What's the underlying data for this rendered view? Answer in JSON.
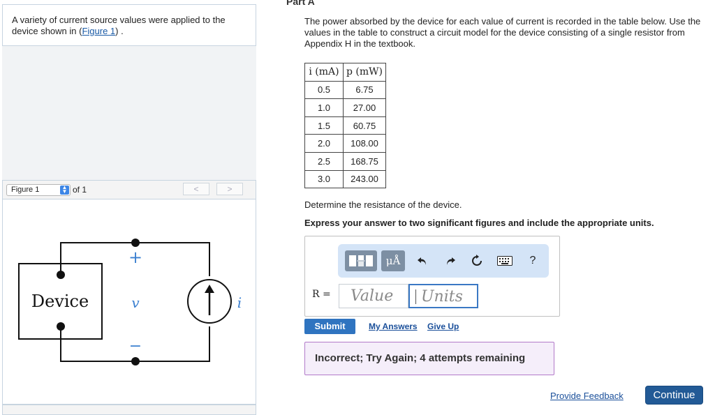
{
  "intro": {
    "text_before": "A variety of current source values were applied to the device shown in (",
    "figure_link": "Figure 1",
    "text_after": ") ."
  },
  "figure_nav": {
    "selected": "Figure 1",
    "of_label": "of 1",
    "prev": "<",
    "next": ">"
  },
  "circuit": {
    "device_label": "Device",
    "plus": "+",
    "minus": "−",
    "voltage_label": "v",
    "current_label": "i"
  },
  "part": {
    "title": "Part A",
    "problem_text": "The power absorbed by the device for each value of current is recorded in the table below. Use the values in the table to construct a circuit model for the device consisting of a single resistor from Appendix H in the textbook."
  },
  "table": {
    "headers": [
      "i (mA)",
      "p (mW)"
    ],
    "rows": [
      [
        "0.5",
        "6.75"
      ],
      [
        "1.0",
        "27.00"
      ],
      [
        "1.5",
        "60.75"
      ],
      [
        "2.0",
        "108.00"
      ],
      [
        "2.5",
        "168.75"
      ],
      [
        "3.0",
        "243.00"
      ]
    ]
  },
  "question": {
    "prompt": "Determine the resistance of the device.",
    "instruction": "Express your answer to two significant figures and include the appropriate units."
  },
  "answer": {
    "label": "R =",
    "value_placeholder": "Value",
    "units_placeholder": "Units",
    "toolbar_icons": [
      "templates-icon",
      "units-mu-icon",
      "undo-icon",
      "redo-icon",
      "reset-icon",
      "keyboard-icon",
      "help-icon"
    ],
    "mu_glyph": "μÅ",
    "help_glyph": "?"
  },
  "actions": {
    "submit": "Submit",
    "my_answers": "My Answers",
    "give_up": "Give Up"
  },
  "feedback": {
    "message": "Incorrect; Try Again; 4 attempts remaining",
    "border_color": "#b27ac9",
    "background_color": "#f5eefa"
  },
  "footer": {
    "provide_feedback": "Provide Feedback",
    "continue": "Continue"
  }
}
